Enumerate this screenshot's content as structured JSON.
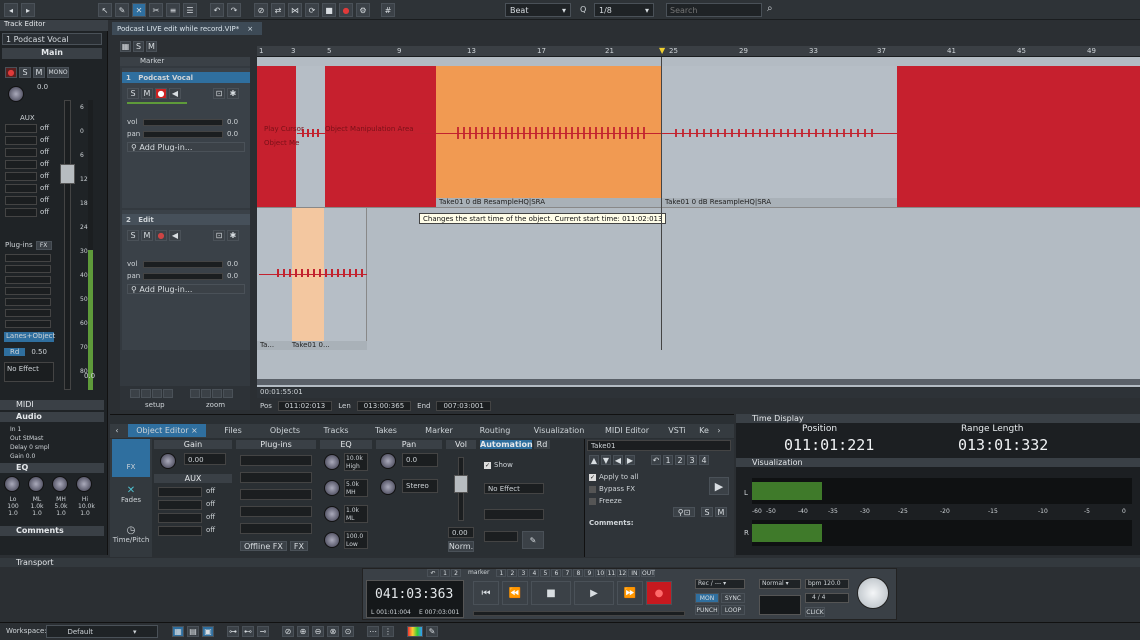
{
  "toolbar": {
    "snap_mode": "Beat",
    "quantize_label": "Q",
    "quantize_value": "1/8",
    "search_placeholder": "Search"
  },
  "track_editor": {
    "title": "Track Editor",
    "selected_track": "1 Podcast Vocal",
    "section_main": "Main",
    "aux_label": "AUX",
    "off": "off",
    "plugins_label": "Plug-ins",
    "fx_label": "FX",
    "lanes_object": "Lanes+Object",
    "rd_label": "Rd",
    "rd_value": "0.50",
    "no_effect": "No Effect",
    "db_values": [
      "0.0",
      "0.0"
    ],
    "scale": [
      "6",
      "0",
      "6",
      "12",
      "18",
      "24",
      "30",
      "40",
      "50",
      "60",
      "70",
      "80"
    ],
    "midi": "MIDI",
    "audio": "Audio",
    "in_label": "In",
    "in_value": "1",
    "out_label": "Out",
    "out_value": "StMast",
    "delay_label": "Delay",
    "delay_value": "0 smpl",
    "gain_label": "Gain",
    "gain_value": "0.0",
    "eq": "EQ",
    "eq_bands": [
      "Lo",
      "ML",
      "MH",
      "Hi"
    ],
    "eq_freqs": [
      "100",
      "1.0k",
      "5.0k",
      "10.0k"
    ],
    "eq_q": [
      "1.0",
      "1.0",
      "1.0",
      "1.0"
    ],
    "comments": "Comments",
    "mono": "MONO"
  },
  "project_tab": "Podcast LIVE edit while record.VIP*",
  "ruler": {
    "labels": [
      "1",
      "3",
      "5",
      "9",
      "13",
      "17",
      "21",
      "25",
      "29",
      "33",
      "37",
      "41",
      "45",
      "49"
    ],
    "marker": "Marker"
  },
  "tracks": [
    {
      "num": "1",
      "name": "Podcast Vocal",
      "vol_label": "vol",
      "vol": "0.0",
      "pan_label": "pan",
      "pan": "0.0",
      "plugin": "Add Plug-in..."
    },
    {
      "num": "2",
      "name": "Edit",
      "vol_label": "vol",
      "vol": "0.0",
      "pan_label": "pan",
      "pan": "0.0",
      "plugin": "Add Plug-in..."
    }
  ],
  "track_controls": {
    "s": "S",
    "m": "M"
  },
  "objects": {
    "text1": "Play Cursor",
    "text2": "Object Manipulation Area",
    "text3": "Object Me",
    "take1": "Take01   0 dB   ResampleHQ|SRA",
    "take2": "Take01   0 dB   ResampleHQ|SRA",
    "take_small": "Ta...",
    "take_small2": "Take01   0..."
  },
  "tooltip": "Changes the start time of the object.  Current start time: 011:02:013",
  "footer": {
    "time": "00:01:55:01",
    "setup": "setup",
    "zoom": "zoom",
    "pos_label": "Pos",
    "pos": "011:02:013",
    "len_label": "Len",
    "len": "013:00:365",
    "end_label": "End",
    "end": "007:03:001"
  },
  "obj_editor": {
    "tabs": [
      "Object Editor",
      "Files",
      "Objects",
      "Tracks",
      "Takes",
      "Marker",
      "Routing",
      "Visualization",
      "MIDI Editor",
      "VSTi",
      "Ke"
    ],
    "side": [
      "FX",
      "Fades",
      "Time/Pitch"
    ],
    "cols": [
      "Gain",
      "Plug-ins",
      "EQ",
      "Pan",
      "Vol",
      "Automation",
      "Rd"
    ],
    "gain": "0.00",
    "aux": "AUX",
    "eq_vals": [
      "10.0k",
      "5.0k",
      "1.0k",
      "100.0"
    ],
    "eq_names": [
      "High",
      "MH",
      "ML",
      "Low"
    ],
    "pan": "0.0",
    "stereo": "Stereo",
    "offline": "Offline FX",
    "fx": "FX",
    "vol": "0.00",
    "norm": "Norm.",
    "show": "Show",
    "no_effect": "No Effect",
    "take": "Take01",
    "apply": "Apply to all",
    "bypass": "Bypass FX",
    "freeze": "Freeze",
    "comments": "Comments:",
    "nums": [
      "1",
      "2",
      "3",
      "4"
    ]
  },
  "time_display": {
    "title": "Time Display",
    "pos_label": "Position",
    "pos": "011:01:221",
    "range_label": "Range Length",
    "range": "013:01:332"
  },
  "visualization": {
    "title": "Visualization",
    "scale": [
      "-60",
      "-50",
      "-40",
      "-35",
      "-30",
      "-25",
      "-20",
      "-15",
      "-10",
      "-5",
      "0"
    ],
    "L": "L",
    "R": "R"
  },
  "transport": {
    "title": "Transport",
    "time": "041:03:363",
    "l": "L 001:01:004",
    "e": "E 007:03:001",
    "marker": "marker",
    "nums": [
      "1",
      "2",
      "3",
      "4",
      "5",
      "6",
      "7",
      "8",
      "9",
      "10",
      "11",
      "12"
    ],
    "in": "IN",
    "out": "OUT",
    "rec": "Rec / ---",
    "mon": "MON",
    "sync": "SYNC",
    "punch": "PUNCH",
    "loop": "LOOP",
    "normal": "Normal",
    "bpm": "bpm 120.0",
    "sig": "4 / 4",
    "click": "CLICK"
  },
  "status": {
    "workspace_label": "Workspace:",
    "workspace": "Default"
  },
  "colors": {
    "red": "#c6202e",
    "orange": "#f19a52",
    "grey": "#b6bec6"
  }
}
